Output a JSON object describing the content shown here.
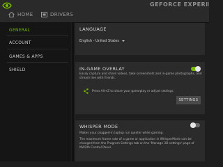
{
  "app": {
    "brand": "GEFORCE EXPERIENCE"
  },
  "top_nav": {
    "home_label": "HOME",
    "drivers_label": "DRIVERS"
  },
  "sidebar": {
    "items": [
      {
        "label": "GENERAL",
        "active": true
      },
      {
        "label": "ACCOUNT",
        "active": false
      },
      {
        "label": "GAMES & APPS",
        "active": false
      },
      {
        "label": "SHIELD",
        "active": false
      }
    ]
  },
  "language": {
    "title": "LANGUAGE",
    "selected": "English - United States"
  },
  "overlay": {
    "title": "IN-GAME OVERLAY",
    "enabled": true,
    "description": "Easily capture and share videos, take screenshots and in-game photographs, and stream live with friends.",
    "hint": "Press Alt+Z to share your gameplay or adjust settings.",
    "settings_label": "SETTINGS"
  },
  "whisper": {
    "title": "WHISPER MODE",
    "enabled": false,
    "description": "Makes your plugged-in laptop run quieter while gaming.",
    "detail": "The maximum frame rate of a game or application in WhisperMode can be changed from the Program Settings tab on the 'Manage 3D settings' page of NVIDIA Control Panel."
  },
  "colors": {
    "accent": "#76b900",
    "toggle_off": "#6a6a6a"
  }
}
